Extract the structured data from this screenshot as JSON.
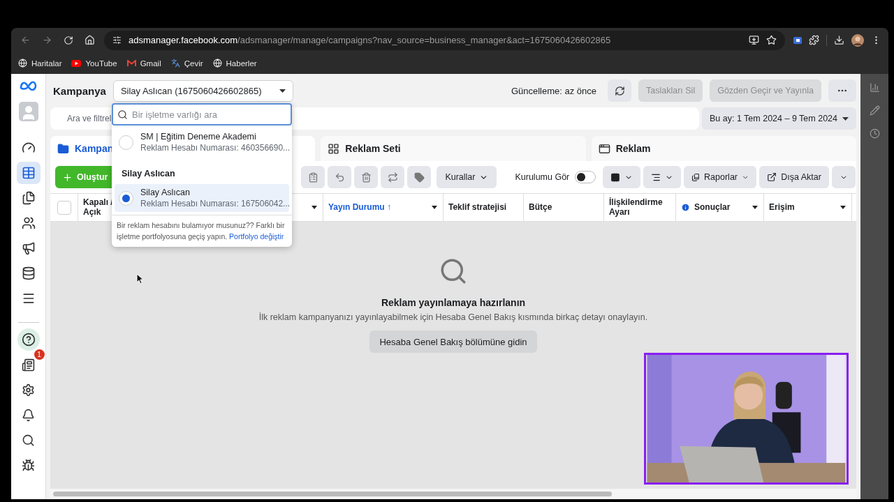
{
  "browser": {
    "url_domain": "adsmanager.facebook.com",
    "url_path": "/adsmanager/manage/campaigns?nav_source=business_manager&act=1675060426602865",
    "bookmarks": [
      "Haritalar",
      "YouTube",
      "Gmail",
      "Çevir",
      "Haberler"
    ]
  },
  "nav": {
    "top": [
      {
        "selected": false
      },
      {
        "selected": true
      },
      {
        "selected": false
      },
      {
        "selected": false
      },
      {
        "selected": false
      },
      {
        "selected": false
      },
      {
        "selected": false
      }
    ],
    "badge": "1"
  },
  "header": {
    "title": "Kampanya",
    "account": "Silay Aslıcan (1675060426602865)",
    "updated": "Güncelleme: az önce",
    "buttons": [
      {
        "label": "Taslakları Sil",
        "disabled": true
      },
      {
        "label": "Gözden Geçir ve Yayınla",
        "disabled": true
      }
    ]
  },
  "search": {
    "placeholder": "Ara ve filtrel"
  },
  "date_range": "Bu ay: 1 Tem 2024 – 9 Tem 2024",
  "tabs": [
    {
      "label": "Kampan",
      "selected": true
    },
    {
      "label": "Reklam Seti",
      "selected": false
    },
    {
      "label": "Reklam",
      "selected": false
    }
  ],
  "toolbar": {
    "create": "Oluştur",
    "rules": "Kurallar",
    "setup_toggle": {
      "label": "Kurulumu Gör",
      "on": false
    },
    "reports": "Raporlar",
    "export": "Dışa Aktar"
  },
  "table": {
    "select_all": {
      "checked": false
    },
    "columns": [
      {
        "label": "Kapalı /\nAçık",
        "sorted": false,
        "info": false
      },
      {
        "sorted": false,
        "caret": true,
        "info": false
      },
      {
        "label": "Yayın Durumu ↑",
        "sorted": true,
        "caret": true,
        "info": false
      },
      {
        "label": "Teklif stratejisi",
        "sorted": false,
        "caret": false,
        "info": false
      },
      {
        "label": "Bütçe",
        "sorted": false,
        "caret": false,
        "info": false
      },
      {
        "label": "İlişkilendirme\nAyarı",
        "sorted": false,
        "caret": false,
        "info": false
      },
      {
        "label": "Sonuçlar",
        "sorted": false,
        "caret": true,
        "info": true
      },
      {
        "label": "Erişim",
        "sorted": false,
        "caret": true,
        "info": false
      }
    ],
    "empty_title": "Reklam yayınlamaya hazırlanın",
    "empty_text": "İlk reklam kampanyanızı yayınlayabilmek için Hesaba Genel Bakış kısmında birkaç detayı onaylayın.",
    "empty_button": "Hesaba Genel Bakış bölümüne gidin"
  },
  "account_dropdown": {
    "placeholder": "Bir işletme varlığı ara",
    "items": [
      {
        "kind": "account",
        "name": "SM | Eğitim Deneme Akademi",
        "number": "Reklam Hesabı Numarası: 460356690...",
        "selected": false
      },
      {
        "kind": "heading",
        "label": "Silay Aslıcan"
      },
      {
        "kind": "account",
        "name": "Silay Aslıcan",
        "number": "Reklam Hesabı Numarası: 167506042...",
        "selected": true
      }
    ],
    "footer": "Bir reklam hesabını bulamıyor musunuz?? Farklı bir işletme portfolyosuna geçiş yapın.",
    "footer_link": "Portfolyo değiştir"
  }
}
